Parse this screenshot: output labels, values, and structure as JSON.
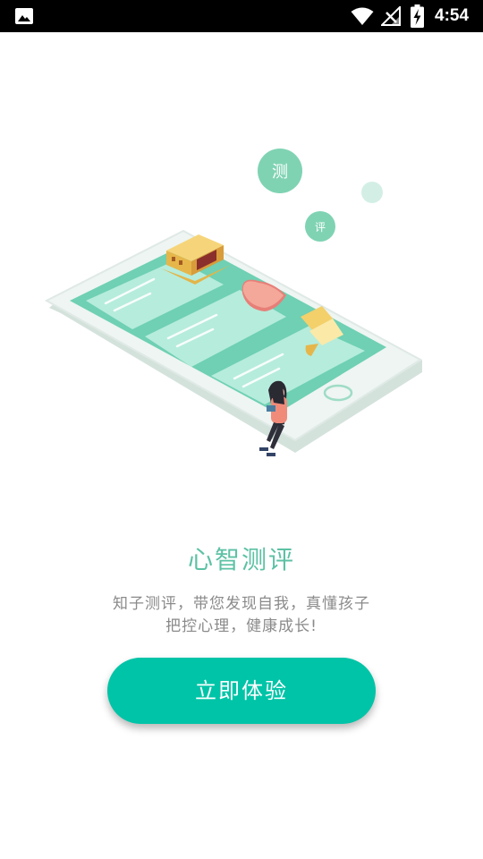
{
  "status_bar": {
    "time": "4:54",
    "icons": [
      "gallery-icon",
      "wifi-icon",
      "no-signal-icon",
      "battery-charging-icon"
    ]
  },
  "illustration": {
    "bubble_large": "测",
    "bubble_small": "评"
  },
  "main": {
    "title": "心智测评",
    "description_line1": "知子测评，带您发现自我，真懂孩子",
    "description_line2": "把控心理，健康成长!",
    "cta_label": "立即体验"
  },
  "colors": {
    "accent": "#00c4a7",
    "title": "#5cc1a4",
    "body_text": "#8a8a8a",
    "status_bar": "#000000"
  }
}
